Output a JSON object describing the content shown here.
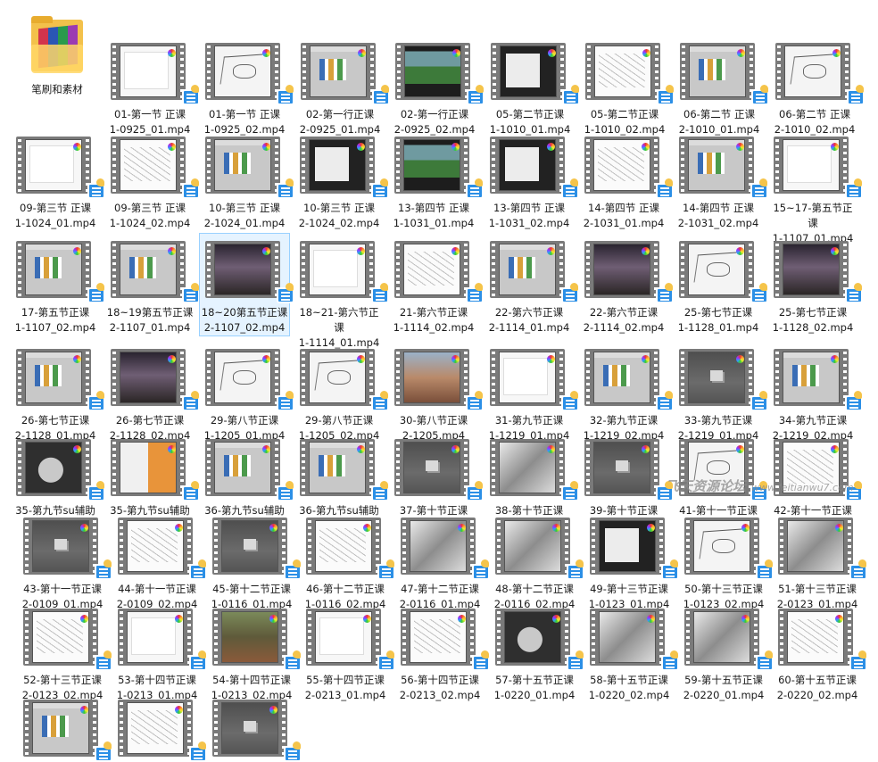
{
  "folder": {
    "name": "笔刷和素材"
  },
  "watermark": {
    "text": "飞天资源论坛",
    "domain": "www.feitianwu7.com"
  },
  "files": [
    {
      "name": "01-第一节 正课\n1-0925_01.mp4",
      "thumb": "white"
    },
    {
      "name": "01-第一节 正课\n1-0925_02.mp4",
      "thumb": "sketch"
    },
    {
      "name": "02-第一行正课\n2-0925_01.mp4",
      "thumb": "ui"
    },
    {
      "name": "02-第一行正课\n2-0925_02.mp4",
      "thumb": "green"
    },
    {
      "name": "05-第二节正课\n1-1010_01.mp4",
      "thumb": "dark"
    },
    {
      "name": "05-第二节正课\n1-1010_02.mp4",
      "thumb": "line"
    },
    {
      "name": "06-第二节 正课\n2-1010_01.mp4",
      "thumb": "ui"
    },
    {
      "name": "06-第二节 正课\n2-1010_02.mp4",
      "thumb": "sketch"
    },
    {
      "name": "09-第三节 正课\n1-1024_01.mp4",
      "thumb": "white"
    },
    {
      "name": "09-第三节 正课\n1-1024_02.mp4",
      "thumb": "line"
    },
    {
      "name": "10-第三节 正课\n2-1024_01.mp4",
      "thumb": "ui"
    },
    {
      "name": "10-第三节 正课\n2-1024_02.mp4",
      "thumb": "dark"
    },
    {
      "name": "13-第四节 正课\n1-1031_01.mp4",
      "thumb": "green"
    },
    {
      "name": "13-第四节 正课\n1-1031_02.mp4",
      "thumb": "dark"
    },
    {
      "name": "14-第四节 正课\n2-1031_01.mp4",
      "thumb": "line"
    },
    {
      "name": "14-第四节 正课\n2-1031_02.mp4",
      "thumb": "ui"
    },
    {
      "name": "15~17-第五节正课\n1-1107_01.mp4",
      "thumb": "white"
    },
    {
      "name": "17-第五节正课\n1-1107_02.mp4",
      "thumb": "ui"
    },
    {
      "name": "18~19第五节正课\n2-1107_01.mp4",
      "thumb": "ui"
    },
    {
      "name": "18~20第五节正课\n2-1107_02.mp4",
      "thumb": "night"
    },
    {
      "name": "18~21-第六节正课\n1-1114_01.mp4",
      "thumb": "white"
    },
    {
      "name": "21-第六节正课\n1-1114_02.mp4",
      "thumb": "line"
    },
    {
      "name": "22-第六节正课\n2-1114_01.mp4",
      "thumb": "ui"
    },
    {
      "name": "22-第六节正课\n2-1114_02.mp4",
      "thumb": "night"
    },
    {
      "name": "25-第七节正课\n1-1128_01.mp4",
      "thumb": "sketch"
    },
    {
      "name": "25-第七节正课\n1-1128_02.mp4",
      "thumb": "night"
    },
    {
      "name": "26-第七节正课\n2-1128_01.mp4",
      "thumb": "ui"
    },
    {
      "name": "26-第七节正课\n2-1128_02.mp4",
      "thumb": "night"
    },
    {
      "name": "29-第八节正课\n1-1205_01.mp4",
      "thumb": "sketch"
    },
    {
      "name": "29-第八节正课\n1-1205_02.mp4",
      "thumb": "sketch"
    },
    {
      "name": "30-第八节正课\n2-1205.mp4",
      "thumb": "city"
    },
    {
      "name": "31-第九节正课\n1-1219_01.mp4",
      "thumb": "white"
    },
    {
      "name": "32-第九节正课\n1-1219_02.mp4",
      "thumb": "ui"
    },
    {
      "name": "33-第九节正课\n2-1219_01.mp4",
      "thumb": "gray3d"
    },
    {
      "name": "34-第九节正课\n2-1219_02.mp4",
      "thumb": "ui"
    },
    {
      "name": "35-第九节su辅助",
      "thumb": "portrait"
    },
    {
      "name": "35-第九节su辅助",
      "thumb": "orange"
    },
    {
      "name": "36-第九节su辅助",
      "thumb": "ui"
    },
    {
      "name": "36-第九节su辅助",
      "thumb": "ui"
    },
    {
      "name": "37-第十节正课",
      "thumb": "gray3d"
    },
    {
      "name": "38-第十节正课",
      "thumb": "mono"
    },
    {
      "name": "39-第十节正课",
      "thumb": "gray3d"
    },
    {
      "name": "41-第十一节正课",
      "thumb": "sketch"
    },
    {
      "name": "42-第十一节正课",
      "thumb": "line"
    },
    {
      "name": "43-第十一节正课\n2-0109_01.mp4",
      "thumb": "gray3d"
    },
    {
      "name": "44-第十一节正课\n2-0109_02.mp4",
      "thumb": "line"
    },
    {
      "name": "45-第十二节正课\n1-0116_01.mp4",
      "thumb": "gray3d"
    },
    {
      "name": "46-第十二节正课\n1-0116_02.mp4",
      "thumb": "line"
    },
    {
      "name": "47-第十二节正课\n2-0116_01.mp4",
      "thumb": "mono"
    },
    {
      "name": "48-第十二节正课\n2-0116_02.mp4",
      "thumb": "mono"
    },
    {
      "name": "49-第十三节正课\n1-0123_01.mp4",
      "thumb": "dark"
    },
    {
      "name": "50-第十三节正课\n1-0123_02.mp4",
      "thumb": "sketch"
    },
    {
      "name": "51-第十三节正课\n2-0123_01.mp4",
      "thumb": "mono"
    },
    {
      "name": "52-第十三节正课\n2-0123_02.mp4",
      "thumb": "line"
    },
    {
      "name": "53-第十四节正课\n1-0213_01.mp4",
      "thumb": "white"
    },
    {
      "name": "54-第十四节正课\n1-0213_02.mp4",
      "thumb": "temple"
    },
    {
      "name": "55-第十四节正课\n2-0213_01.mp4",
      "thumb": "white"
    },
    {
      "name": "56-第十四节正课\n2-0213_02.mp4",
      "thumb": "line"
    },
    {
      "name": "57-第十五节正课\n1-0220_01.mp4",
      "thumb": "portrait"
    },
    {
      "name": "58-第十五节正课\n1-0220_02.mp4",
      "thumb": "mono"
    },
    {
      "name": "59-第十五节正课\n2-0220_01.mp4",
      "thumb": "mono"
    },
    {
      "name": "60-第十五节正课\n2-0220_02.mp4",
      "thumb": "line"
    },
    {
      "name": "",
      "thumb": "ui"
    },
    {
      "name": "",
      "thumb": "line"
    },
    {
      "name": "",
      "thumb": "gray3d"
    }
  ]
}
